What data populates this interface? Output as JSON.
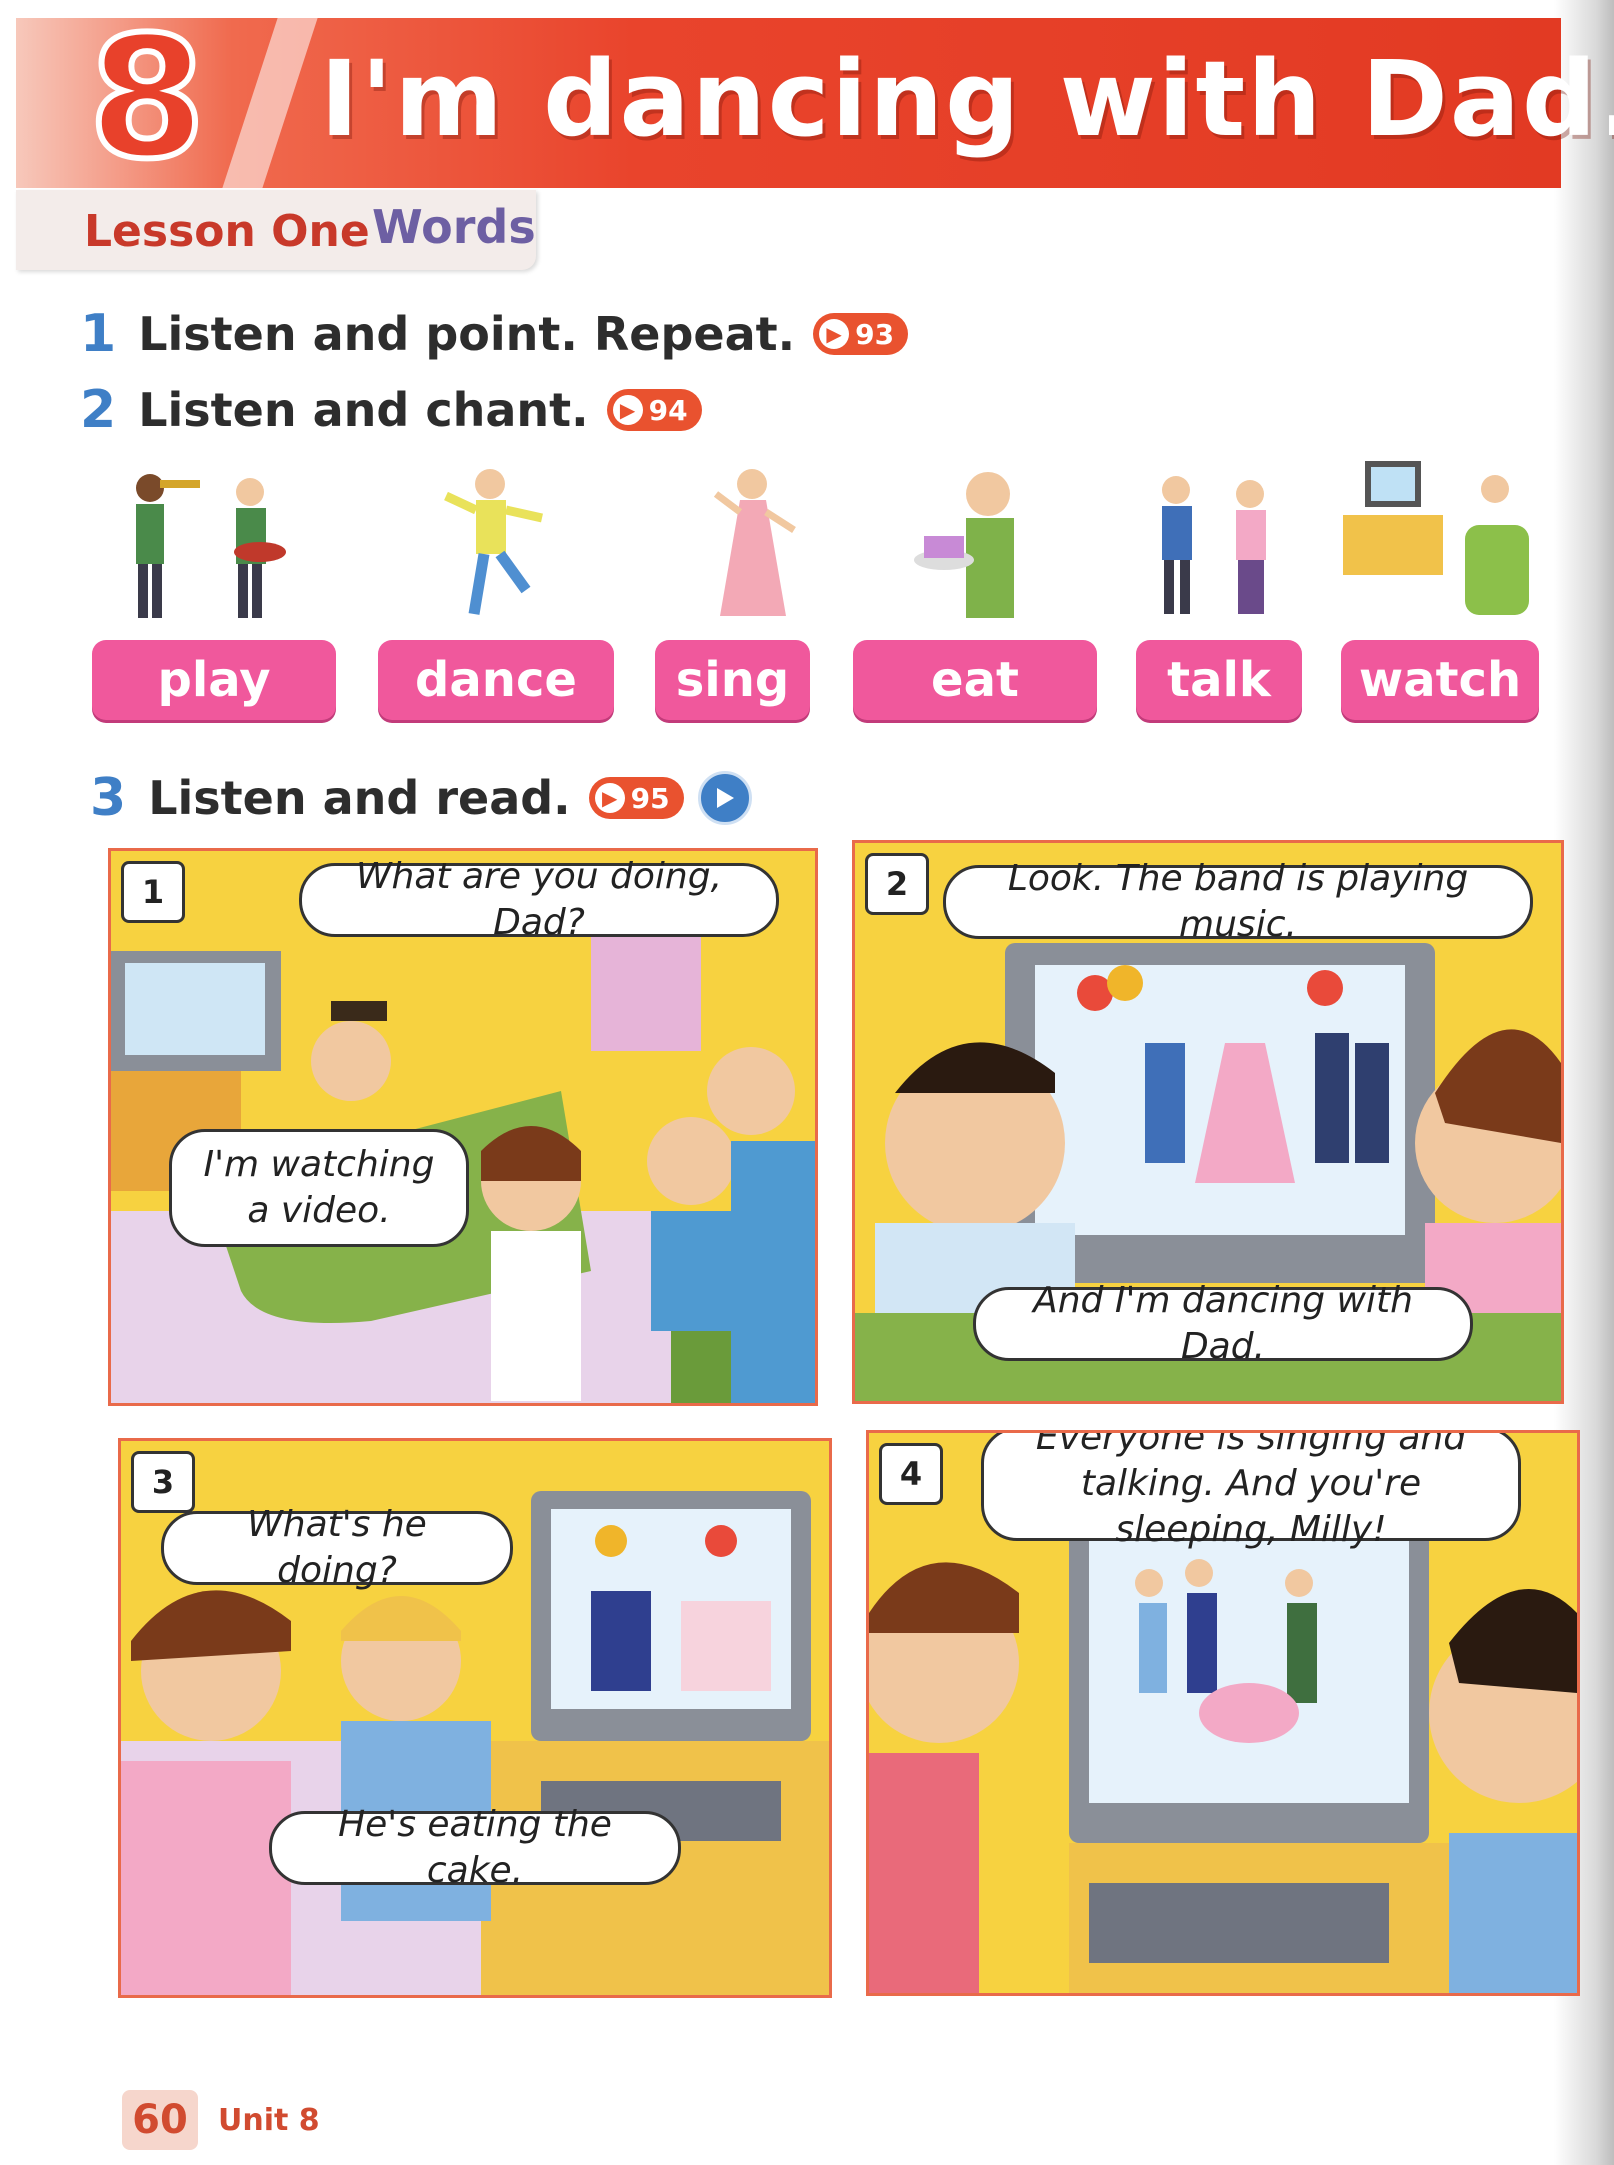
{
  "header": {
    "unit_number": "8",
    "title": "I'm dancing with Dad.",
    "lesson": "Lesson One",
    "lesson_type": "Words"
  },
  "activities": [
    {
      "number": "1",
      "text": "Listen and point. Repeat.",
      "track": "93"
    },
    {
      "number": "2",
      "text": "Listen and chant.",
      "track": "94"
    },
    {
      "number": "3",
      "text": "Listen and read.",
      "track": "95"
    }
  ],
  "words": [
    "play",
    "dance",
    "sing",
    "eat",
    "talk",
    "watch"
  ],
  "comic": [
    {
      "number": "1",
      "bubbles": [
        "What are you doing, Dad?",
        "I'm watching a video."
      ]
    },
    {
      "number": "2",
      "bubbles": [
        "Look. The band is playing music.",
        "And I'm dancing with Dad."
      ]
    },
    {
      "number": "3",
      "bubbles": [
        "What's he doing?",
        "He's eating the cake."
      ]
    },
    {
      "number": "4",
      "bubbles": [
        "Everyone is singing and talking. And you're sleeping, Milly!"
      ]
    }
  ],
  "footer": {
    "page_number": "60",
    "unit_label": "Unit 8"
  },
  "colors": {
    "header_red": "#e23a23",
    "word_pink": "#f0589c",
    "number_blue": "#3f7fc6",
    "audio_orange": "#e9522f"
  }
}
